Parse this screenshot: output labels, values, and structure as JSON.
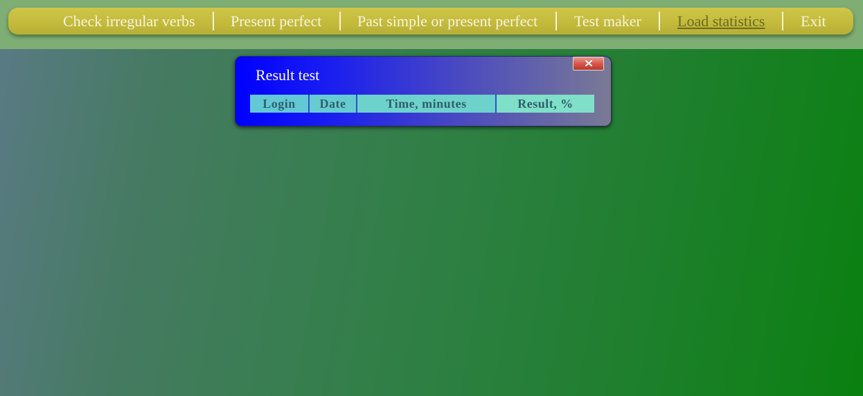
{
  "menu": {
    "items": [
      {
        "label": "Check irregular verbs",
        "active": false
      },
      {
        "label": "Present perfect",
        "active": false
      },
      {
        "label": "Past simple or present perfect",
        "active": false
      },
      {
        "label": "Test maker",
        "active": false
      },
      {
        "label": "Load statistics",
        "active": true
      },
      {
        "label": "Exit",
        "active": false
      }
    ]
  },
  "dialog": {
    "title": "Result test",
    "close_icon": "close-icon",
    "table": {
      "columns": [
        "Login",
        "Date",
        "Time, minutes",
        "Result, %"
      ],
      "rows": []
    }
  },
  "colors": {
    "menubar": "#c4bb3c",
    "menu_text": "#f6f4dc",
    "menu_active_text": "#6b6a22",
    "dialog_start": "#0000ff",
    "dialog_end": "#7a7a95",
    "table_header_text": "#2f5f6a",
    "background_left": "#5a7a85",
    "background_right": "#0a8010"
  }
}
